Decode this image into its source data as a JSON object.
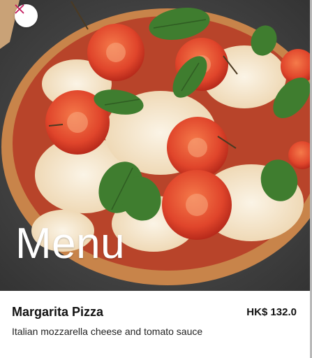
{
  "header": {
    "title": "Menu",
    "close_icon": "close-icon",
    "close_color": "#c2185b"
  },
  "item": {
    "name": "Margarita Pizza",
    "price": "HK$ 132.0",
    "description": "Italian mozzarella cheese and tomato sauce"
  }
}
